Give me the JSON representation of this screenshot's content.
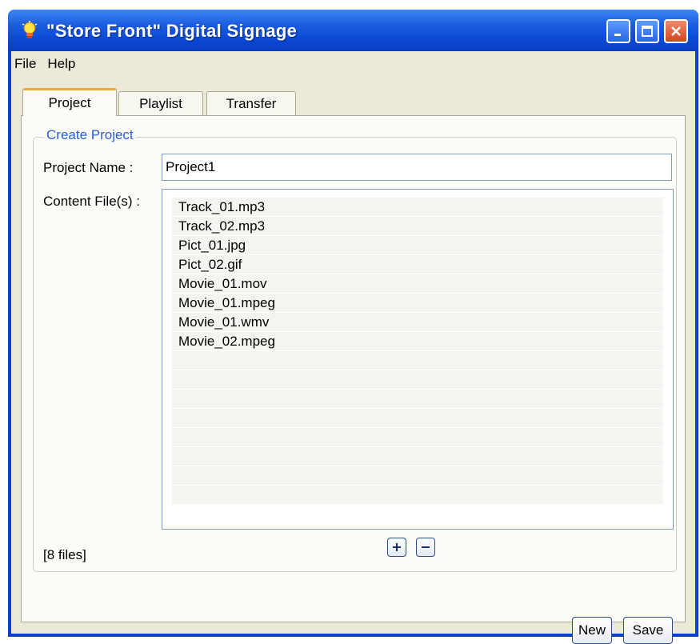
{
  "window": {
    "title": "\"Store Front\" Digital Signage"
  },
  "menu": {
    "items": [
      "File",
      "Help"
    ]
  },
  "tabs": [
    {
      "label": "Project",
      "active": true
    },
    {
      "label": "Playlist",
      "active": false
    },
    {
      "label": "Transfer",
      "active": false
    }
  ],
  "project": {
    "group_title": "Create Project",
    "name_label": "Project Name  :",
    "name_value": "Project1",
    "content_label": "Content File(s) :",
    "files": [
      "Track_01.mp3",
      "Track_02.mp3",
      "Pict_01.jpg",
      "Pict_02.gif",
      "Movie_01.mov",
      "Movie_01.mpeg",
      "Movie_01.wmv",
      "Movie_02.mpeg"
    ],
    "file_count": "[8 files]",
    "add_label": "+",
    "remove_label": "−"
  },
  "actions": {
    "new_label": "New",
    "save_label": "Save"
  },
  "icons": {
    "app": "lightbulb-icon",
    "minimize": "minimize-icon",
    "maximize": "maximize-icon",
    "close": "close-icon"
  },
  "colors": {
    "title_bar": "#0b48d4",
    "accent_tab": "#f0a83a",
    "group_title": "#2a5fd0"
  }
}
